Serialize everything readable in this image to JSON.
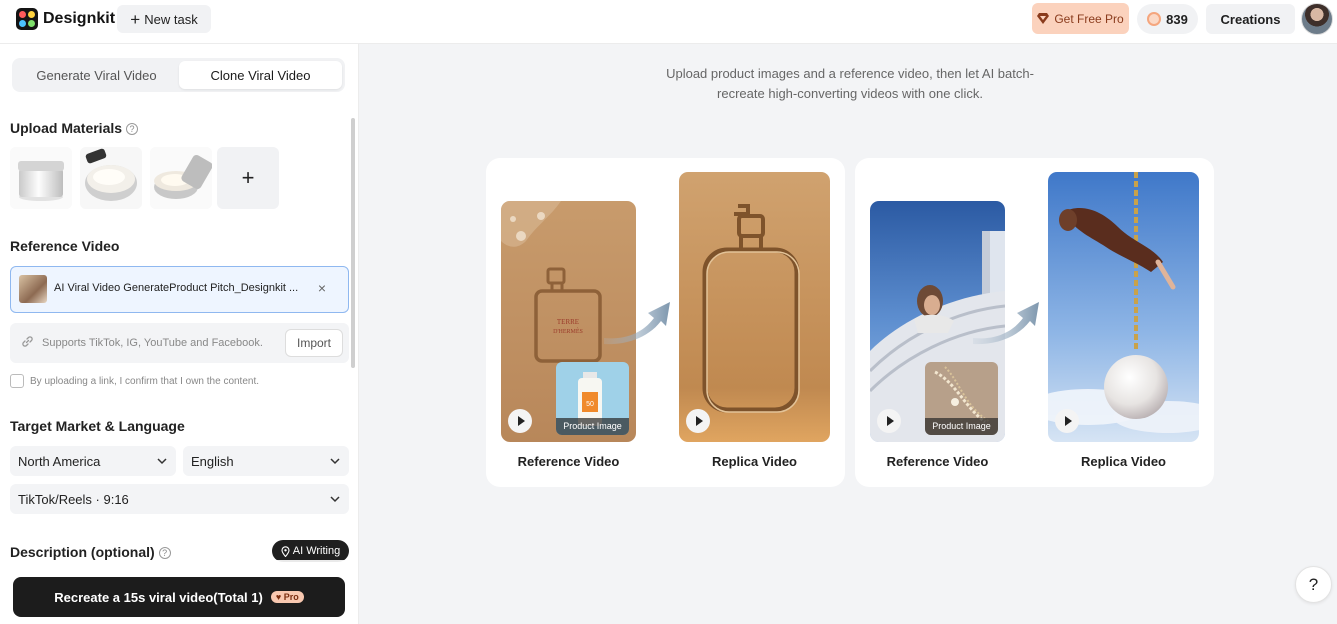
{
  "app": {
    "brand": "Designkit",
    "new_task": "New task"
  },
  "header": {
    "get_pro": "Get Free Pro",
    "credits": "839",
    "creations": "Creations"
  },
  "sidebar": {
    "tabs": [
      {
        "label": "Generate Viral Video",
        "active": false
      },
      {
        "label": "Clone Viral Video",
        "active": true
      }
    ],
    "upload_title": "Upload Materials",
    "reference_title": "Reference Video",
    "reference_file": "AI Viral Video GenerateProduct Pitch_Designkit ...",
    "link_placeholder": "Supports TikTok, IG, YouTube and Facebook.",
    "import_label": "Import",
    "confirm_text": "By uploading a link, I confirm that I own the content.",
    "market_title": "Target Market & Language",
    "market": "North America",
    "language": "English",
    "format": "TikTok/Reels · 9:16",
    "description_title": "Description (optional)",
    "ai_writing": "AI Writing",
    "recreate_label": "Recreate a 15s viral video(Total 1)",
    "pro_badge": "Pro"
  },
  "main": {
    "intro_line1": "Upload product images and a reference video, then let AI batch-",
    "intro_line2": "recreate high-converting videos with one click.",
    "examples": [
      {
        "ref_label": "Reference Video",
        "replica_label": "Replica Video",
        "product_label": "Product Image",
        "bottle_text": "TERRE D'HERMÈS",
        "product_text": "50"
      },
      {
        "ref_label": "Reference Video",
        "replica_label": "Replica Video",
        "product_label": "Product Image"
      }
    ],
    "help": "?"
  }
}
